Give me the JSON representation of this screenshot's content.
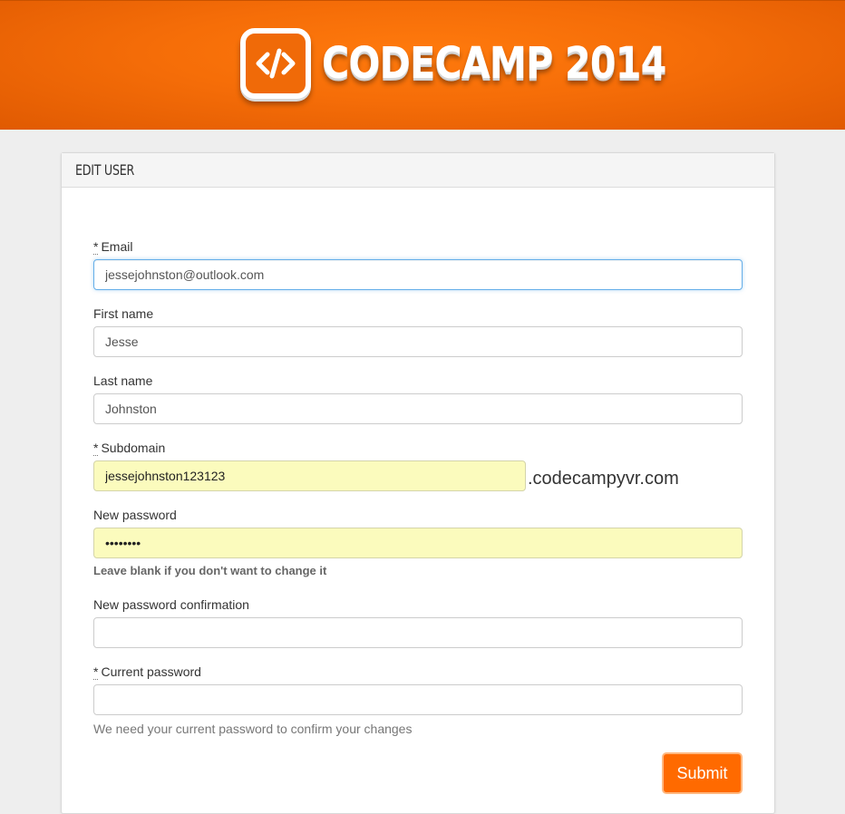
{
  "header": {
    "logo_icon": "code-brackets-icon",
    "logo_text": "CODECAMP 2014",
    "brand_color": "#ff6a00"
  },
  "form": {
    "title": "EDIT USER",
    "required_marker": "*",
    "email": {
      "label": "Email",
      "value": "jessejohnston@outlook.com"
    },
    "first_name": {
      "label": "First name",
      "value": "Jesse"
    },
    "last_name": {
      "label": "Last name",
      "value": "Johnston"
    },
    "subdomain": {
      "label": "Subdomain",
      "value": "jessejohnston123123",
      "suffix": ".codecampyvr.com"
    },
    "new_password": {
      "label": "New password",
      "value": "••••••••",
      "help": "Leave blank if you don't want to change it"
    },
    "new_password_confirmation": {
      "label": "New password confirmation",
      "value": ""
    },
    "current_password": {
      "label": "Current password",
      "value": "",
      "help": "We need your current password to confirm your changes"
    },
    "submit_label": "Submit"
  }
}
